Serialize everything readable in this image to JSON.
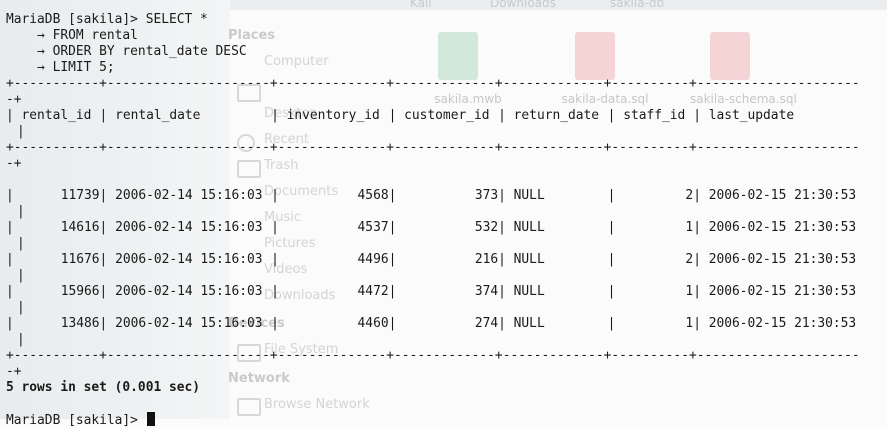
{
  "background_window": {
    "tabs": [
      "Kali",
      "Downloads",
      "sakila-db"
    ],
    "sidebar_places_heading": "Places",
    "sidebar_devices_heading": "Devices",
    "sidebar_network_heading": "Network",
    "sidebar_items": [
      "Computer",
      "Desktop",
      "Recent",
      "Trash",
      "Documents",
      "Music",
      "Pictures",
      "Videos",
      "Downloads",
      "File System",
      "Browse Network"
    ],
    "files": [
      {
        "name": "sakila.mwb",
        "color": "#39a26a"
      },
      {
        "name": "sakila-data.sql",
        "color": "#d94b4b"
      },
      {
        "name": "sakila-schema.sql",
        "color": "#d94b4b"
      }
    ]
  },
  "terminal": {
    "prompt": "MariaDB [sakila]> ",
    "query_lines": [
      "SELECT *",
      "    → FROM rental",
      "    → ORDER BY rental_date DESC",
      "    → LIMIT 5;"
    ],
    "separator": "+-----------+---------------------+--------------+-------------+-------------+----------+---------------------",
    "separator_tail": "-+",
    "columns": [
      "rental_id",
      "rental_date",
      "inventory_id",
      "customer_id",
      "return_date",
      "staff_id",
      "last_update"
    ],
    "rows": [
      [
        "11739",
        "2006-02-14 15:16:03",
        "4568",
        "373",
        "NULL",
        "2",
        "2006-02-15 21:30:53"
      ],
      [
        "14616",
        "2006-02-14 15:16:03",
        "4537",
        "532",
        "NULL",
        "1",
        "2006-02-15 21:30:53"
      ],
      [
        "11676",
        "2006-02-14 15:16:03",
        "4496",
        "216",
        "NULL",
        "2",
        "2006-02-15 21:30:53"
      ],
      [
        "15966",
        "2006-02-14 15:16:03",
        "4472",
        "374",
        "NULL",
        "1",
        "2006-02-15 21:30:53"
      ],
      [
        "13486",
        "2006-02-14 15:16:03",
        "4460",
        "274",
        "NULL",
        "1",
        "2006-02-15 21:30:53"
      ]
    ],
    "result_summary": "5 rows in set (0.001 sec)",
    "final_prompt": "MariaDB [sakila]> "
  }
}
